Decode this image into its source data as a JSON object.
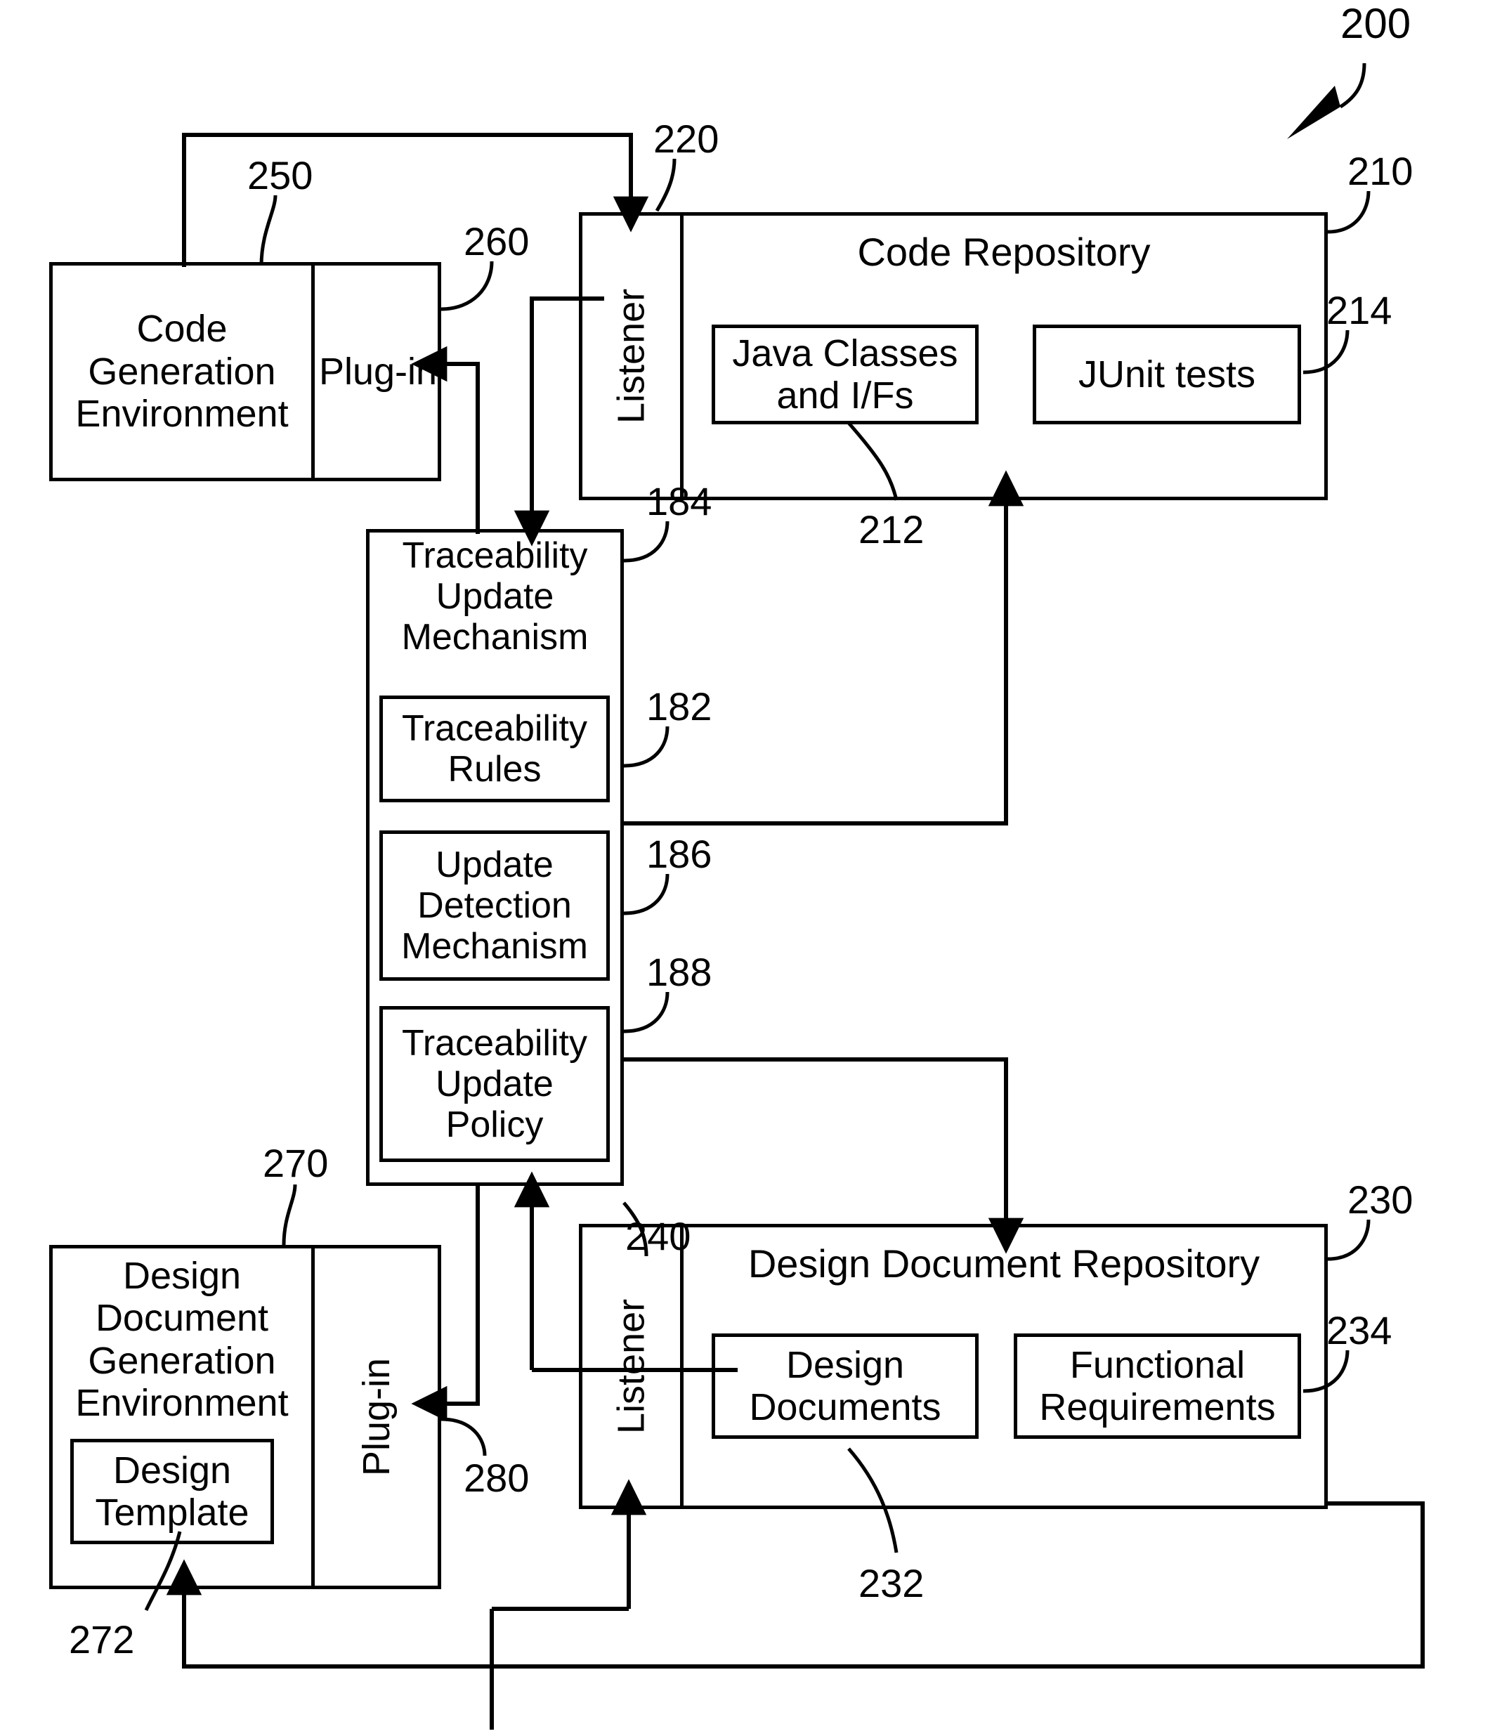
{
  "figure": {
    "number": "200",
    "type": "patent-block-diagram"
  },
  "blocks": {
    "code_generation_environment": {
      "label": "Code\nGeneration\nEnvironment",
      "ref": "250"
    },
    "code_plugin": {
      "label": "Plug-in",
      "ref": "260"
    },
    "code_listener": {
      "label": "Listener",
      "ref": "220"
    },
    "code_repository": {
      "label": "Code Repository",
      "ref": "210"
    },
    "java_classes": {
      "label": "Java Classes\nand I/Fs",
      "ref": "212"
    },
    "junit_tests": {
      "label": "JUnit tests",
      "ref": "214"
    },
    "traceability_update_mechanism": {
      "label": "Traceability\nUpdate\nMechanism",
      "ref": "184"
    },
    "traceability_rules": {
      "label": "Traceability\nRules",
      "ref": "182"
    },
    "update_detection_mechanism": {
      "label": "Update\nDetection\nMechanism",
      "ref": "186"
    },
    "traceability_update_policy": {
      "label": "Traceability\nUpdate\nPolicy",
      "ref": "188"
    },
    "design_document_generation_environment": {
      "label": "Design\nDocument\nGeneration\nEnvironment",
      "ref": "270"
    },
    "design_template": {
      "label": "Design\nTemplate",
      "ref": "272"
    },
    "design_plugin": {
      "label": "Plug-in",
      "ref": "280"
    },
    "design_listener": {
      "label": "Listener",
      "ref": "240"
    },
    "design_document_repository": {
      "label": "Design Document Repository",
      "ref": "230"
    },
    "design_documents": {
      "label": "Design\nDocuments",
      "ref": "232"
    },
    "functional_requirements": {
      "label": "Functional\nRequirements",
      "ref": "234"
    }
  },
  "style": {
    "stroke": "#000000",
    "background": "#ffffff"
  }
}
